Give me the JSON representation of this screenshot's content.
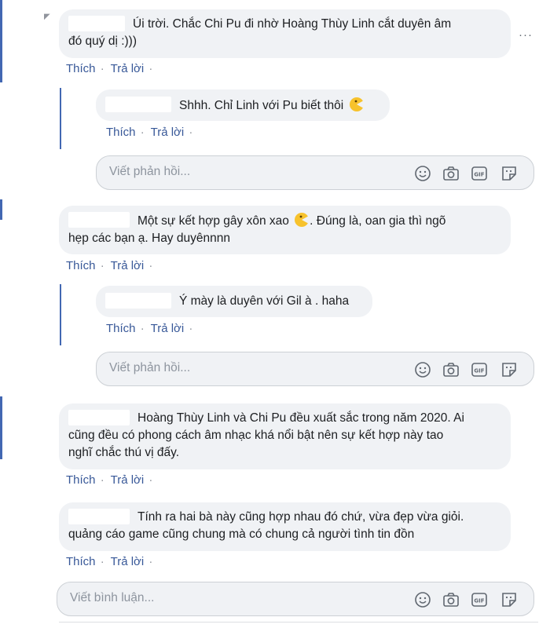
{
  "comments": [
    {
      "text_line1": "Úi trời. Chắc Chi Pu đi nhờ Hoàng Thùy Linh cắt duyên âm",
      "text_line2": "đó quý dị :)))",
      "like": "Thích",
      "reply": "Trả lời",
      "sep": "·",
      "replies": [
        {
          "text": "Shhh. Chỉ Linh với Pu biết thôi",
          "emoji": "pacman-emoji",
          "like": "Thích",
          "reply": "Trả lời",
          "sep": "·"
        }
      ]
    },
    {
      "text_line1": "Một sự kết hợp gây xôn xao",
      "text_line1_after": ". Đúng là, oan gia thì ngõ",
      "text_line2": "hẹp các bạn ạ. Hay duyênnnn",
      "like": "Thích",
      "reply": "Trả lời",
      "sep": "·",
      "replies": [
        {
          "text": "Ý mày là duyên với Gil à . haha",
          "like": "Thích",
          "reply": "Trả lời",
          "sep": "·"
        }
      ]
    },
    {
      "text_line1": "Hoàng Thùy Linh và Chi Pu đều xuất sắc trong năm 2020. Ai",
      "text_line2": "cũng đều có phong cách âm nhạc khá nổi bật nên sự kết hợp này tao",
      "text_line3": "nghĩ chắc thú vị đấy.",
      "like": "Thích",
      "reply": "Trả lời",
      "sep": "·"
    },
    {
      "text_line1": "Tính ra hai bà này cũng hợp nhau đó chứ, vừa đẹp vừa giỏi.",
      "text_line2": "quảng cáo game cũng chung mà có chung cả người tình tin đồn",
      "like": "Thích",
      "reply": "Trả lời",
      "sep": "·"
    }
  ],
  "reply_box": {
    "placeholder": "Viết phản hồi..."
  },
  "comment_box": {
    "placeholder": "Viết bình luận..."
  },
  "composer_icons": [
    "emoji-icon",
    "camera-icon",
    "gif-icon",
    "sticker-icon"
  ],
  "colors": {
    "link": "#385898",
    "bubble": "#f0f2f5",
    "thread_line": "#4267b2",
    "placeholder": "#8d949e"
  }
}
